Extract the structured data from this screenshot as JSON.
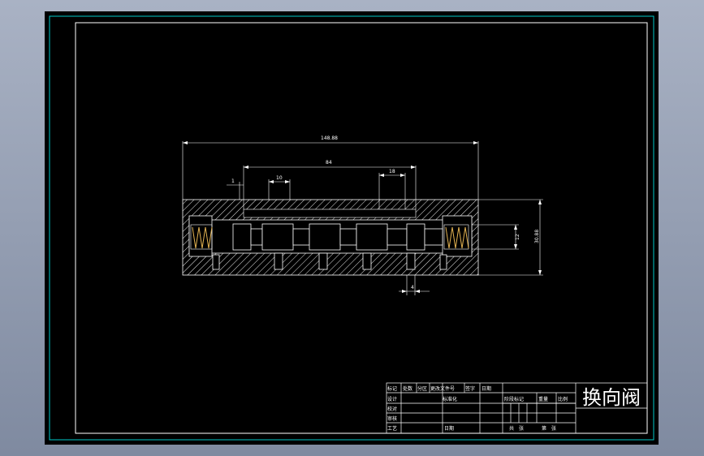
{
  "dimensions": {
    "overall_length": "148.88",
    "inner_span": "84",
    "left_offset": "1",
    "port_width": "10",
    "right_port_width": "18",
    "bore": "12",
    "height": "30.88",
    "bottom_offset": "4"
  },
  "title_block": {
    "drawing_title": "换向阀",
    "rev_headers": [
      "标记",
      "处数",
      "分区",
      "更改文件号",
      "签字",
      "日期"
    ],
    "design_label": "设计",
    "check_label": "校对",
    "review_label": "审核",
    "process_label": "工艺",
    "standardize_label": "标准化",
    "approve_date_label": "日期",
    "stage_label": "阶段标记",
    "weight_label": "重量",
    "scale_label": "比例",
    "total_sheets": "共　张",
    "sheet_no": "第　张"
  },
  "colors": {
    "frame": "#00c8c8",
    "lines": "#ffffff",
    "background": "#000000",
    "spring": "#e0b050"
  }
}
